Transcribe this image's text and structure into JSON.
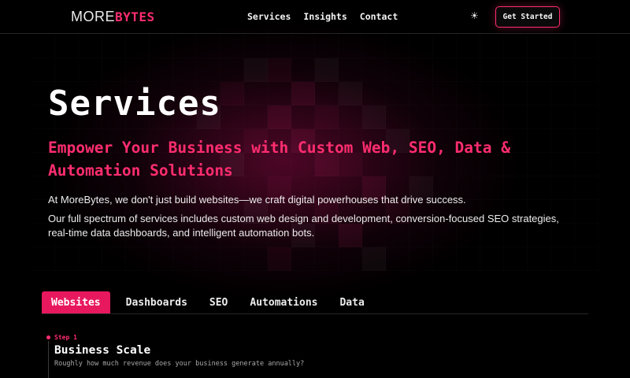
{
  "header": {
    "logo": {
      "part1": "MORE",
      "part2": "BYTES"
    },
    "nav": [
      "Services",
      "Insights",
      "Contact"
    ],
    "theme_icon": "sun-icon",
    "cta_label": "Get Started"
  },
  "hero": {
    "title": "Services",
    "subtitle": "Empower Your Business with Custom Web, SEO, Data & Automation Solutions",
    "intro": "At MoreBytes, we don't just build websites—we craft digital powerhouses that drive success.",
    "description": "Our full spectrum of services includes custom web design and development, conversion-focused SEO strategies, real-time data dashboards, and intelligent automation bots."
  },
  "tabs": {
    "items": [
      "Websites",
      "Dashboards",
      "SEO",
      "Automations",
      "Data"
    ],
    "active": "Websites"
  },
  "step": {
    "label": "Step 1",
    "title": "Business Scale",
    "question": "Roughly how much revenue does your business generate annually?"
  },
  "colors": {
    "accent": "#ff2d6f",
    "active_tab": "#e8185f",
    "background": "#000000"
  }
}
